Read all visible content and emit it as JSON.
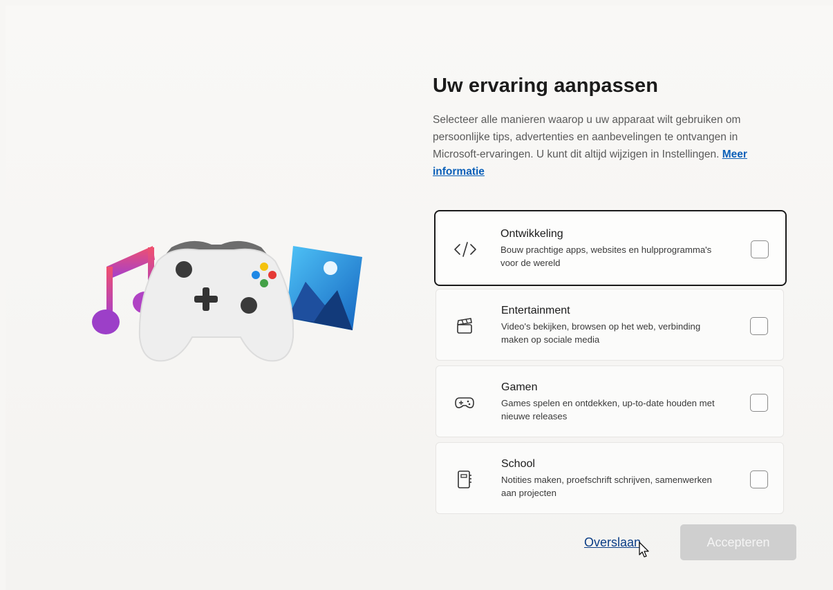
{
  "header": {
    "title": "Uw ervaring aanpassen",
    "description": "Selecteer alle manieren waarop u uw apparaat wilt gebruiken om persoonlijke tips, advertenties en aanbevelingen te ontvangen in Microsoft-ervaringen. U kunt dit altijd wijzigen in Instellingen.",
    "more_info_link": "Meer informatie"
  },
  "options": [
    {
      "label": "Ontwikkeling",
      "description": "Bouw prachtige apps, websites en hulpprogramma's voor de wereld",
      "icon": "code-icon",
      "checked": false,
      "focused": true
    },
    {
      "label": "Entertainment",
      "description": "Video's bekijken, browsen op het web, verbinding maken op sociale media",
      "icon": "clapperboard-icon",
      "checked": false,
      "focused": false
    },
    {
      "label": "Gamen",
      "description": "Games spelen en ontdekken, up-to-date houden met nieuwe releases",
      "icon": "gamepad-icon",
      "checked": false,
      "focused": false
    },
    {
      "label": "School",
      "description": "Notities maken, proefschrift schrijven, samenwerken aan projecten",
      "icon": "notebook-icon",
      "checked": false,
      "focused": false
    }
  ],
  "footer": {
    "skip_label": "Overslaan",
    "accept_label": "Accepteren",
    "accept_enabled": false
  },
  "colors": {
    "link": "#0a5fb8",
    "focus_border": "#1a1a1a",
    "disabled_button": "#cfcfcf"
  }
}
